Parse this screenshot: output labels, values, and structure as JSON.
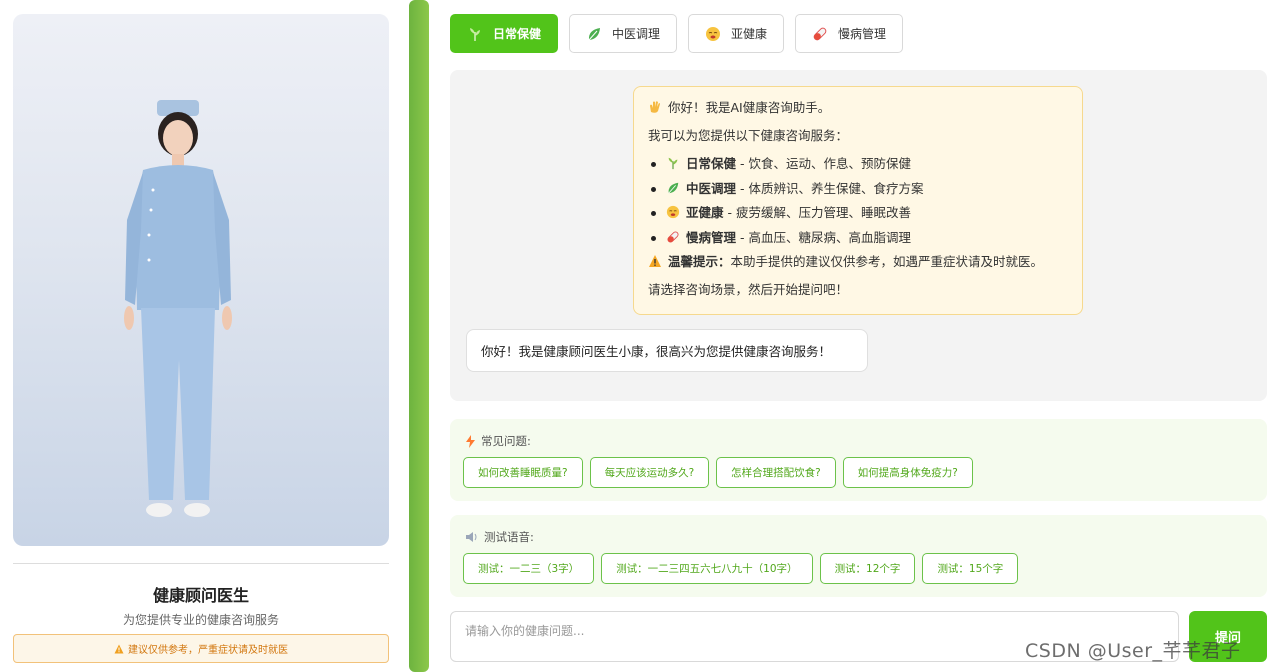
{
  "left_panel": {
    "doctor_name": "健康顾问医生",
    "doctor_desc": "为您提供专业的健康咨询服务",
    "disclaimer": "建议仅供参考，严重症状请及时就医"
  },
  "tabs": [
    {
      "label": "日常保健",
      "icon": "herb-icon",
      "active": true
    },
    {
      "label": "中医调理",
      "icon": "leaf-icon",
      "active": false
    },
    {
      "label": "亚健康",
      "icon": "tired-face-icon",
      "active": false
    },
    {
      "label": "慢病管理",
      "icon": "pill-icon",
      "active": false
    }
  ],
  "welcome": {
    "greeting": "你好！我是AI健康咨询助手。",
    "intro": "我可以为您提供以下健康咨询服务：",
    "services": [
      {
        "name": "日常保健",
        "desc": " - 饮食、运动、作息、预防保健",
        "icon": "herb-icon"
      },
      {
        "name": "中医调理",
        "desc": " - 体质辨识、养生保健、食疗方案",
        "icon": "leaf-icon"
      },
      {
        "name": "亚健康",
        "desc": " - 疲劳缓解、压力管理、睡眠改善",
        "icon": "tired-face-icon"
      },
      {
        "name": "慢病管理",
        "desc": " - 高血压、糖尿病、高血脂调理",
        "icon": "pill-icon"
      }
    ],
    "tip_label": "温馨提示：",
    "tip_text": "本助手提供的建议仅供参考，如遇严重症状请及时就医。",
    "closing": "请选择咨询场景，然后开始提问吧！"
  },
  "bot_message": "你好！我是健康顾问医生小康，很高兴为您提供健康咨询服务！",
  "faq": {
    "title": "常见问题:",
    "items": [
      "如何改善睡眠质量?",
      "每天应该运动多久?",
      "怎样合理搭配饮食?",
      "如何提高身体免疫力?"
    ]
  },
  "voice_test": {
    "title": "测试语音:",
    "items": [
      "测试：一二三（3字）",
      "测试：一二三四五六七八九十（10字）",
      "测试：12个字",
      "测试：15个字"
    ]
  },
  "input": {
    "placeholder": "请输入你的健康问题..."
  },
  "send_label": "提问",
  "watermark": "CSDN @User_芊芊君子",
  "colors": {
    "accent": "#52c41a",
    "warning_bg": "#fff8e5",
    "chip_border": "#6cc24a"
  }
}
